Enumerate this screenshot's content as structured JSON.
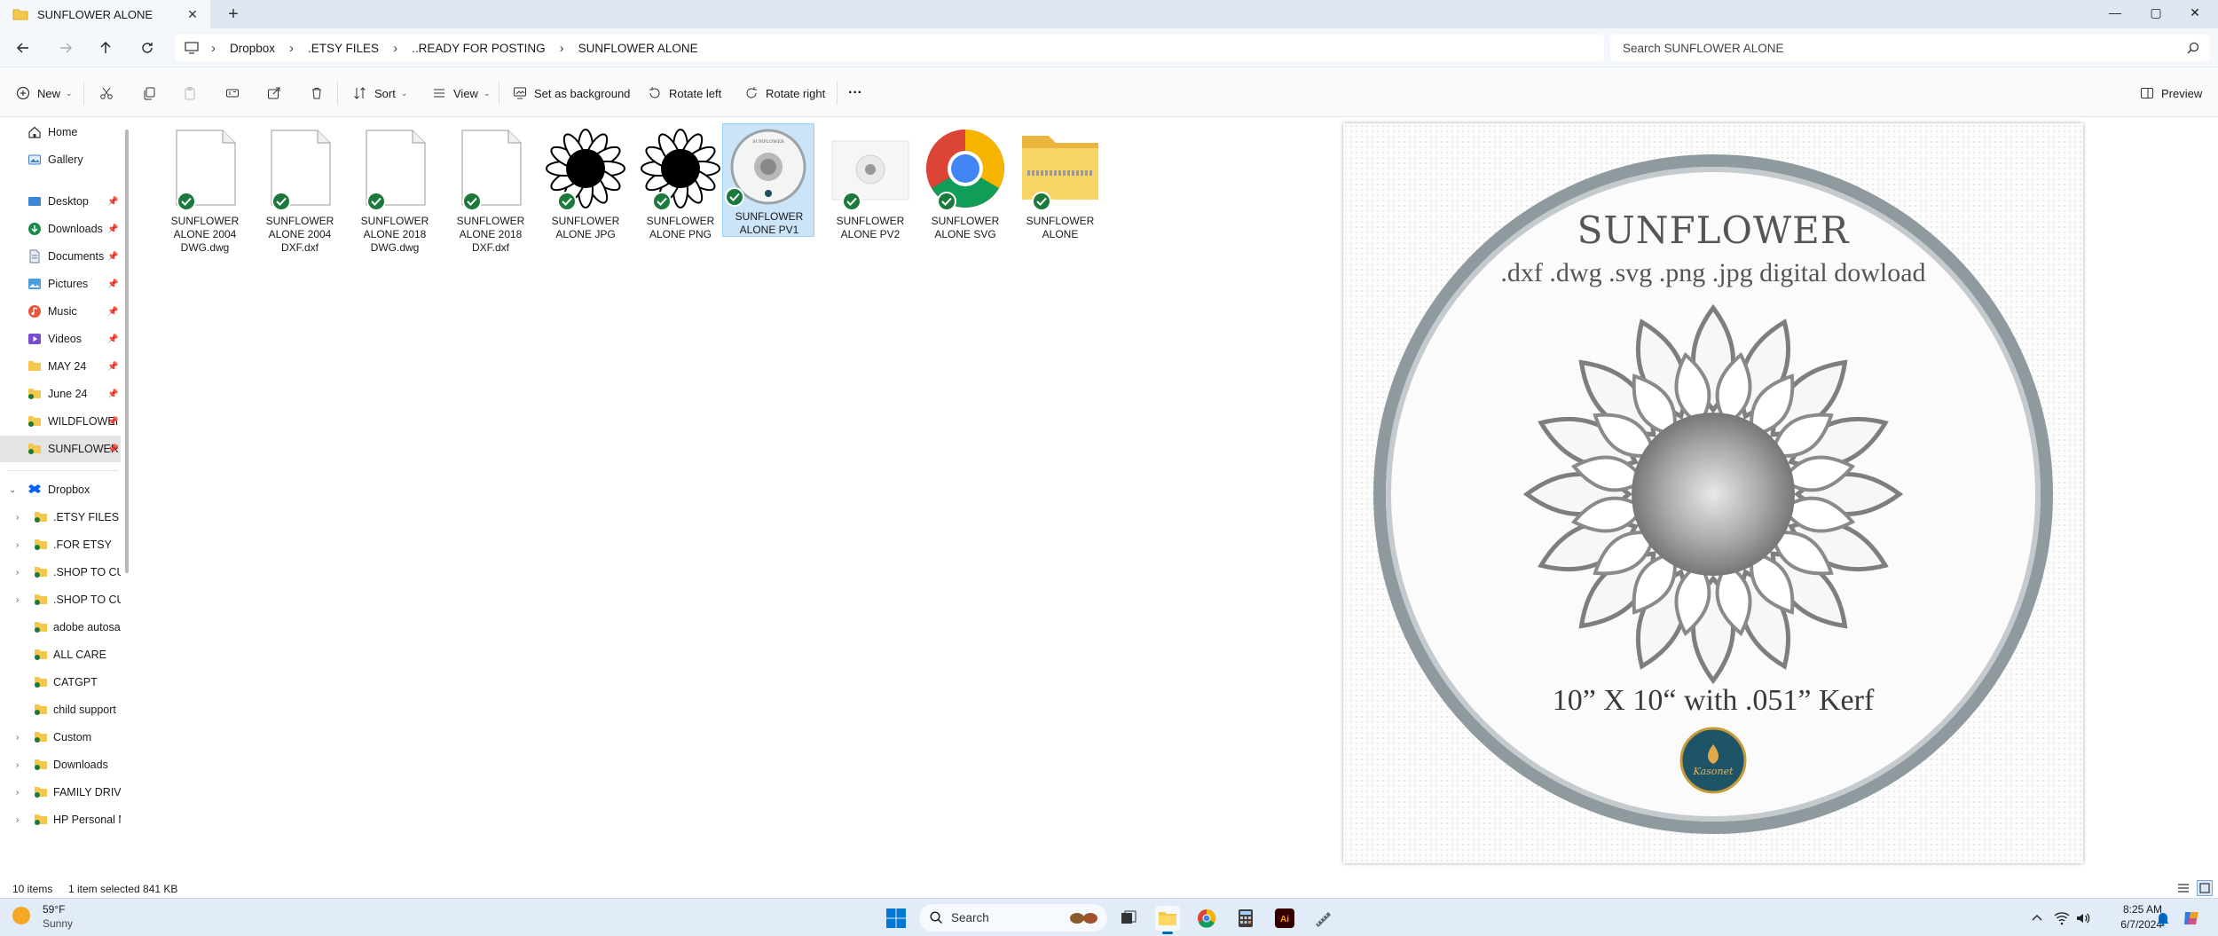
{
  "tab": {
    "title": "SUNFLOWER ALONE",
    "close_glyph": "✕",
    "new_glyph": "+"
  },
  "window": {
    "minimize": "—",
    "maximize": "▢",
    "close": "✕"
  },
  "breadcrumb": [
    "Dropbox",
    ".ETSY FILES",
    "..READY FOR POSTING",
    "SUNFLOWER ALONE"
  ],
  "breadcrumb_sep": "›",
  "search": {
    "placeholder": "Search SUNFLOWER ALONE"
  },
  "toolbar": {
    "new": "New",
    "sort": "Sort",
    "view": "View",
    "set_background": "Set as background",
    "rotate_left": "Rotate left",
    "rotate_right": "Rotate right",
    "more": "···",
    "preview": "Preview",
    "caret": "⌄"
  },
  "nav": {
    "pin": "📌",
    "chev_closed": "›",
    "chev_open": "⌄",
    "quick": [
      "Home",
      "Gallery"
    ],
    "pinned": [
      "Desktop",
      "Downloads",
      "Documents",
      "Pictures",
      "Music",
      "Videos",
      "MAY 24",
      "June 24",
      "WILDFLOWEI",
      "SUNFLOWER"
    ],
    "dropbox": "Dropbox",
    "folders": [
      ".ETSY FILES",
      ".FOR ETSY",
      ".SHOP TO CUT",
      ".SHOP TO CUT",
      "adobe autosav",
      "ALL CARE",
      "CATGPT",
      "child support",
      "Custom",
      "Downloads",
      "FAMILY DRIVEI",
      "HP Personal M"
    ]
  },
  "files": [
    {
      "name": "SUNFLOWER ALONE 2004 DWG.dwg",
      "kind": "doc"
    },
    {
      "name": "SUNFLOWER ALONE 2004 DXF.dxf",
      "kind": "doc"
    },
    {
      "name": "SUNFLOWER ALONE 2018 DWG.dwg",
      "kind": "doc"
    },
    {
      "name": "SUNFLOWER ALONE 2018 DXF.dxf",
      "kind": "doc"
    },
    {
      "name": "SUNFLOWER ALONE JPG",
      "kind": "flower"
    },
    {
      "name": "SUNFLOWER ALONE PNG",
      "kind": "flower"
    },
    {
      "name": "SUNFLOWER ALONE PV1",
      "kind": "pv1"
    },
    {
      "name": "SUNFLOWER ALONE PV2",
      "kind": "pv2"
    },
    {
      "name": "SUNFLOWER ALONE SVG",
      "kind": "chrome"
    },
    {
      "name": "SUNFLOWER ALONE",
      "kind": "zip"
    }
  ],
  "preview_image": {
    "title": "SUNFLOWER",
    "formats": ".dxf .dwg .svg .png .jpg digital dowload",
    "size": "10” X 10“ with .051” Kerf",
    "logo": "Kasonet"
  },
  "status": {
    "items": "10 items",
    "selected": "1 item selected  841 KB"
  },
  "taskbar": {
    "weather_temp": "59°F",
    "weather_desc": "Sunny",
    "search": "Search",
    "time": "8:25 AM",
    "date": "6/7/2024"
  },
  "colors": {
    "accent": "#0067c0",
    "check": "#1b7a3b",
    "selection": "#cce4f7",
    "folder": "#f5c84c"
  }
}
